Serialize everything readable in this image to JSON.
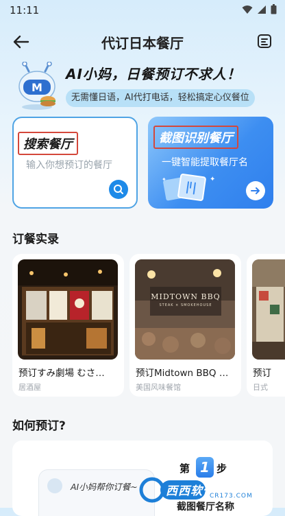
{
  "status_bar": {
    "time": "11:11",
    "icons": [
      "wifi-icon",
      "signal-icon",
      "battery-icon"
    ]
  },
  "nav": {
    "title": "代订日本餐厅",
    "back_icon": "back-arrow-icon",
    "menu_icon": "menu-icon"
  },
  "hero": {
    "title": "AI小妈，日餐预订不求人！",
    "subtitle": "无需懂日语，AI代打电话，轻松搞定心仪餐位"
  },
  "cards": {
    "search": {
      "title": "搜索餐厅",
      "subtitle": "输入你想预订的餐厅",
      "action_icon": "search-icon"
    },
    "scan": {
      "title": "截图识别餐厅",
      "subtitle": "一键智能提取餐厅名",
      "action_icon": "arrow-right-icon"
    }
  },
  "records": {
    "title": "订餐实录",
    "items": [
      {
        "name": "预订すみ劇場 むさ…",
        "category": "居酒屋"
      },
      {
        "name": "预订Midtown BBQ …",
        "category": "美国风味餐馆",
        "sign": "MIDTOWN BBQ",
        "sign_sub": "STEAK × SMOKEHOUSE"
      },
      {
        "name": "预订",
        "category": "日式"
      }
    ]
  },
  "howto": {
    "title": "如何预订?",
    "chat_text": "AI小妈帮你订餐~",
    "step_prefix": "第",
    "step_number": "1",
    "step_suffix": "步",
    "step_text": "截图餐厅名称"
  },
  "watermark": {
    "text": "西西软件园",
    "url": "CR173.COM"
  },
  "colors": {
    "accent": "#1e8ae8",
    "highlight_box": "#d4473a",
    "hero_sub_bg": "#a0d6f4"
  }
}
